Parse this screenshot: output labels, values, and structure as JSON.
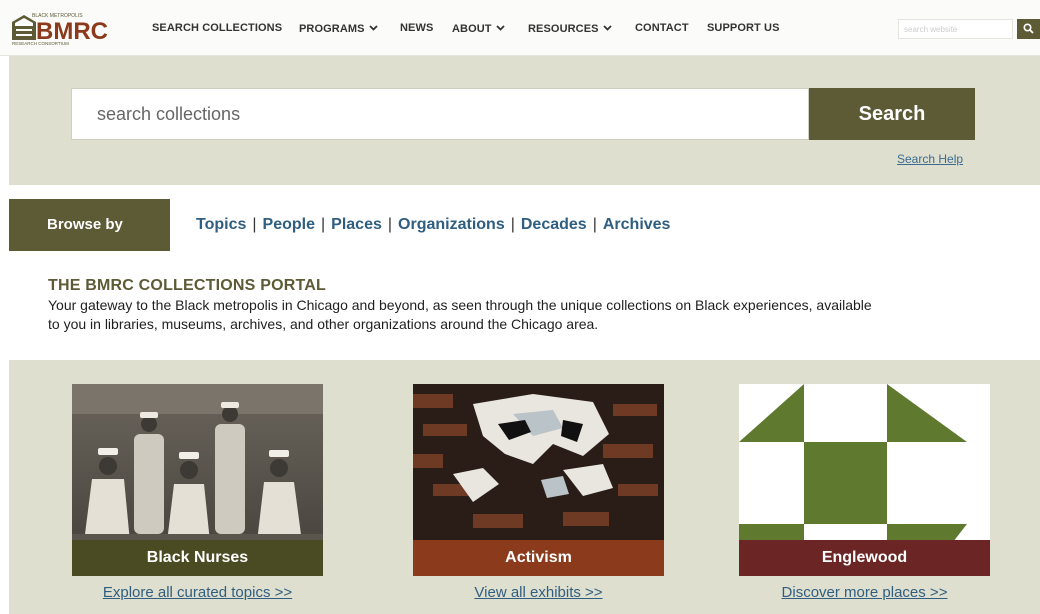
{
  "logo": {
    "text": "BMRC",
    "top_text": "BLACK METROPOLIS",
    "bottom_text": "RESEARCH CONSORTIUM"
  },
  "nav": {
    "items": [
      {
        "label": "SEARCH COLLECTIONS",
        "has_dropdown": false
      },
      {
        "label": "PROGRAMS",
        "has_dropdown": true
      },
      {
        "label": "NEWS",
        "has_dropdown": false
      },
      {
        "label": "ABOUT",
        "has_dropdown": true
      },
      {
        "label": "RESOURCES",
        "has_dropdown": true
      },
      {
        "label": "CONTACT",
        "has_dropdown": false
      },
      {
        "label": "SUPPORT US",
        "has_dropdown": false
      }
    ],
    "search_placeholder": "search website",
    "search_button_icon": "search-icon"
  },
  "hero": {
    "search_placeholder": "search collections",
    "search_button": "Search",
    "help_link": "Search Help"
  },
  "browse": {
    "label": "Browse by",
    "links": [
      "Topics",
      "People",
      "Places",
      "Organizations",
      "Decades",
      "Archives"
    ],
    "separator": "|"
  },
  "portal": {
    "title": "THE BMRC COLLECTIONS PORTAL",
    "description": "Your gateway to the Black metropolis in Chicago and beyond, as seen through the unique collections on Black experiences, available to you in libraries, museums, archives, and other organizations around the Chicago area."
  },
  "cards": [
    {
      "title": "Black Nurses",
      "link": "Explore all curated topics >>",
      "title_bg": "#4a4a23"
    },
    {
      "title": "Activism",
      "link": "View all exhibits >>",
      "title_bg": "#8b3a1c"
    },
    {
      "title": "Englewood",
      "link": "Discover more places >>",
      "title_bg": "#6c2525"
    }
  ],
  "colors": {
    "accent": "#5d5a36",
    "panel": "#dfdfcf",
    "link": "#2f5e80",
    "quilt_green": "#5f7a2e"
  }
}
